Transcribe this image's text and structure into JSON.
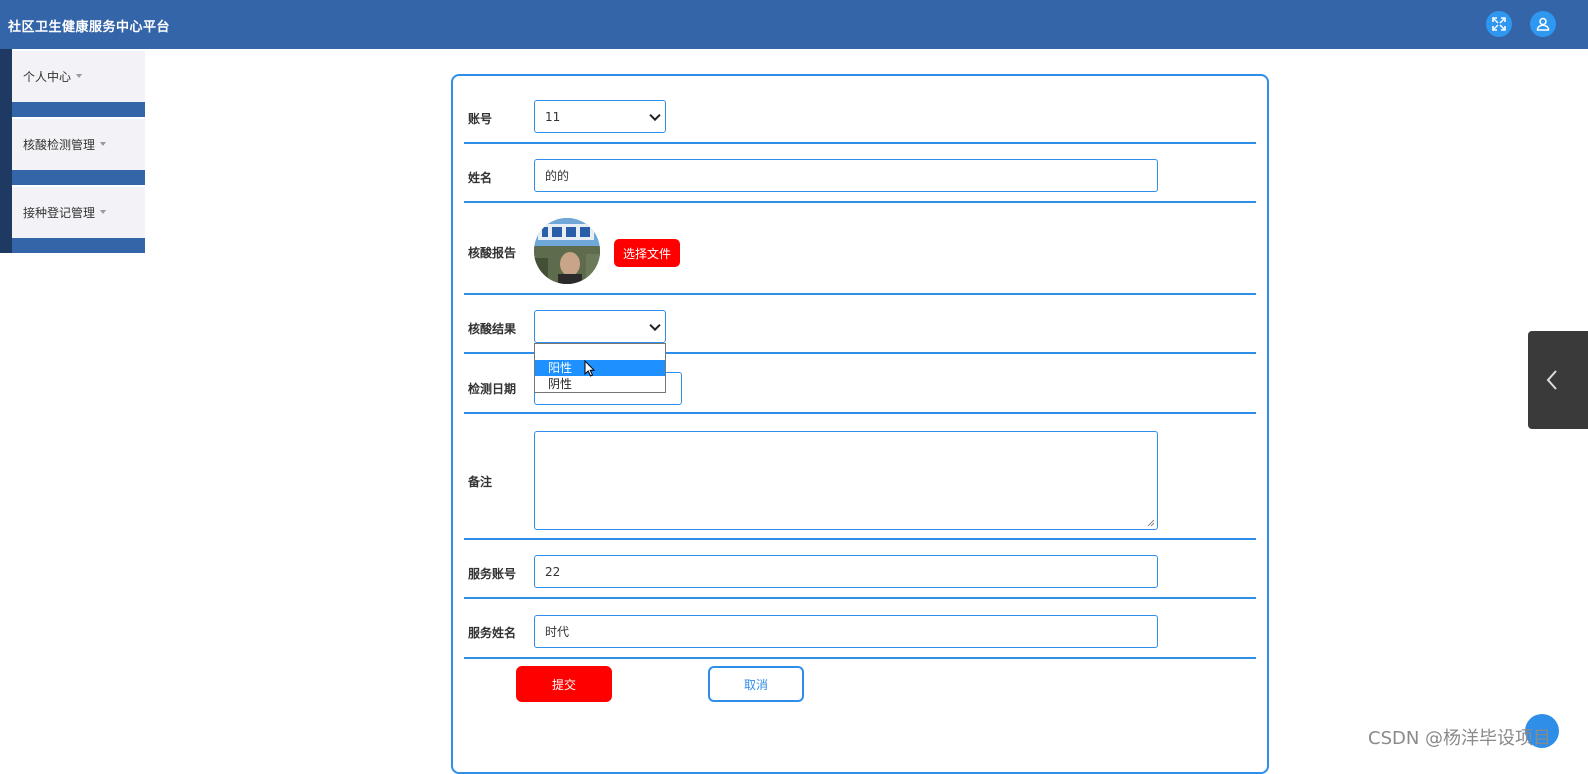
{
  "header": {
    "title": "社区卫生健康服务中心平台",
    "icons": [
      "fullscreen-icon",
      "user-icon"
    ]
  },
  "sidebar": {
    "items": [
      {
        "label": "个人中心"
      },
      {
        "label": "核酸检测管理"
      },
      {
        "label": "接种登记管理"
      }
    ]
  },
  "form": {
    "account": {
      "label": "账号",
      "value": "11"
    },
    "name": {
      "label": "姓名",
      "value": "的的"
    },
    "report": {
      "label": "核酸报告",
      "button": "选择文件"
    },
    "result": {
      "label": "核酸结果",
      "value": "",
      "options": [
        "",
        "阳性",
        "阴性"
      ],
      "highlighted": "阳性"
    },
    "date": {
      "label": "检测日期",
      "value": ""
    },
    "remark": {
      "label": "备注",
      "value": ""
    },
    "service_account": {
      "label": "服务账号",
      "value": "22"
    },
    "service_name": {
      "label": "服务姓名",
      "value": "时代"
    },
    "submit": "提交",
    "cancel": "取消"
  },
  "watermark": "CSDN @杨洋毕设项目",
  "colors": {
    "header_bg": "#3465a8",
    "accent": "#2f8ee8",
    "danger": "#ff0000",
    "sidebar_dark": "#1e3a63"
  }
}
